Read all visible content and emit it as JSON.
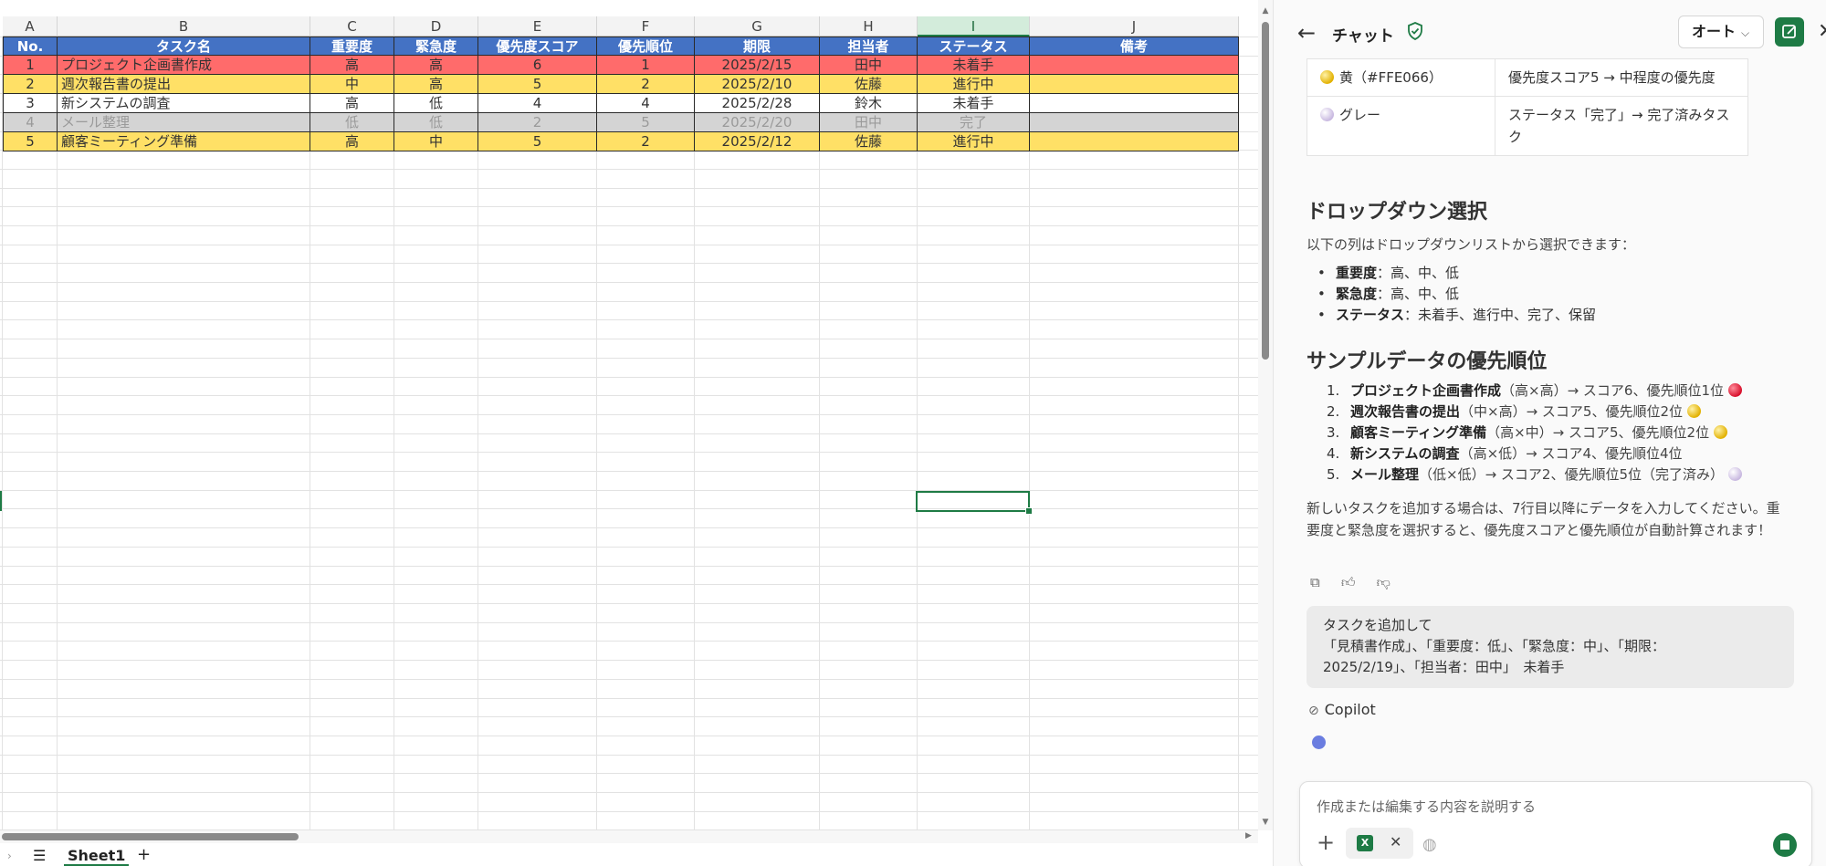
{
  "sheet": {
    "column_letters": [
      "A",
      "B",
      "C",
      "D",
      "E",
      "F",
      "G",
      "H",
      "I",
      "J"
    ],
    "selected_column": "I",
    "header_row": [
      "No.",
      "タスク名",
      "重要度",
      "緊急度",
      "優先度スコア",
      "優先順位",
      "期限",
      "担当者",
      "ステータス",
      "備考"
    ],
    "rows": [
      {
        "style": "red",
        "cells": [
          "1",
          "プロジェクト企画書作成",
          "高",
          "高",
          "6",
          "1",
          "2025/2/15",
          "田中",
          "未着手",
          ""
        ]
      },
      {
        "style": "yellow",
        "cells": [
          "2",
          "週次報告書の提出",
          "中",
          "高",
          "5",
          "2",
          "2025/2/10",
          "佐藤",
          "進行中",
          ""
        ]
      },
      {
        "style": "white",
        "cells": [
          "3",
          "新システムの調査",
          "高",
          "低",
          "4",
          "4",
          "2025/2/28",
          "鈴木",
          "未着手",
          ""
        ]
      },
      {
        "style": "gray",
        "cells": [
          "4",
          "メール整理",
          "低",
          "低",
          "2",
          "5",
          "2025/2/20",
          "田中",
          "完了",
          ""
        ]
      },
      {
        "style": "yellow",
        "cells": [
          "5",
          "顧客ミーティング準備",
          "高",
          "中",
          "5",
          "2",
          "2025/2/12",
          "佐藤",
          "進行中",
          ""
        ]
      }
    ],
    "sheet_tab": "Sheet1",
    "colors": {
      "header": "#4472c4",
      "red": "#ff6b6b",
      "yellow": "#ffe066",
      "gray": "#d4d4d4"
    }
  },
  "panel": {
    "title": "チャット",
    "mode_label": "オート",
    "color_table": [
      {
        "dot": "yellow",
        "label": "黄（#FFE066）",
        "desc": "優先度スコア5 → 中程度の優先度"
      },
      {
        "dot": "gray",
        "label": "グレー",
        "desc": "ステータス「完了」→ 完了済みタスク"
      }
    ],
    "dropdown_heading": "ドロップダウン選択",
    "dropdown_intro": "以下の列はドロップダウンリストから選択できます：",
    "dropdown_items": [
      {
        "name": "重要度",
        "values": "：高、中、低"
      },
      {
        "name": "緊急度",
        "values": "：高、中、低"
      },
      {
        "name": "ステータス",
        "values": "：未着手、進行中、完了、保留"
      }
    ],
    "priority_heading": "サンプルデータの優先順位",
    "priority_items": [
      {
        "num": "1.",
        "name": "プロジェクト企画書作成",
        "rest": "（高×高）→ スコア6、優先順位1位",
        "dot": "red"
      },
      {
        "num": "2.",
        "name": "週次報告書の提出",
        "rest": "（中×高）→ スコア5、優先順位2位",
        "dot": "yellow"
      },
      {
        "num": "3.",
        "name": "顧客ミーティング準備",
        "rest": "（高×中）→ スコア5、優先順位2位",
        "dot": "yellow"
      },
      {
        "num": "4.",
        "name": "新システムの調査",
        "rest": "（高×低）→ スコア4、優先順位4位",
        "dot": ""
      },
      {
        "num": "5.",
        "name": "メール整理",
        "rest": "（低×低）→ スコア2、優先順位5位（完了済み）",
        "dot": "gray"
      }
    ],
    "closing_text": "新しいタスクを追加する場合は、7行目以降にデータを入力してください。重要度と緊急度を選択すると、優先度スコアと優先順位が自動計算されます！",
    "user_message_line1": "タスクを追加して",
    "user_message_line2": "「見積書作成」、「重要度：低」、「緊急度：中」、「期限：",
    "user_message_line3": "2025/2/19」、「担当者：田中」　未着手",
    "copilot_label": "Copilot",
    "composer_placeholder": "作成または編集する内容を説明する",
    "file_chip_label": "X"
  }
}
